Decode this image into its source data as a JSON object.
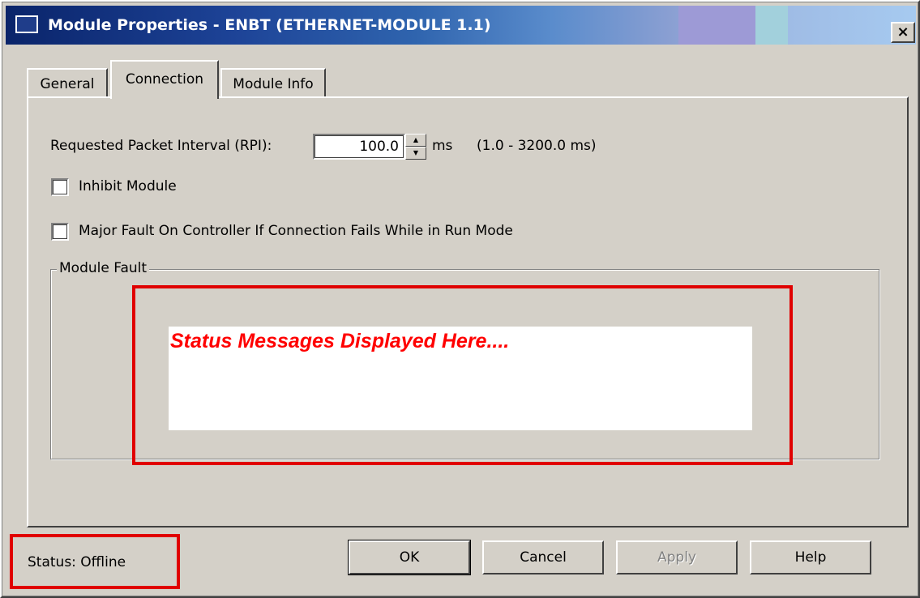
{
  "window": {
    "title": "Module Properties  - ENBT (ETHERNET-MODULE 1.1)",
    "close_label": "×"
  },
  "tabs": [
    {
      "label": "General",
      "active": false
    },
    {
      "label": "Connection",
      "active": true
    },
    {
      "label": "Module Info",
      "active": false
    }
  ],
  "connection": {
    "rpi_label": "Requested Packet Interval (RPI):",
    "rpi_value": "100.0",
    "rpi_unit": "ms",
    "rpi_range": "(1.0 - 3200.0 ms)",
    "inhibit_label": "Inhibit Module",
    "inhibit_checked": false,
    "major_fault_label": "Major Fault On Controller If Connection Fails While in Run Mode",
    "major_fault_checked": false
  },
  "module_fault": {
    "legend": "Module Fault",
    "status_message": "Status Messages Displayed Here...."
  },
  "status": {
    "text": "Status:  Offline"
  },
  "buttons": {
    "ok": "OK",
    "cancel": "Cancel",
    "apply": "Apply",
    "help": "Help"
  },
  "colors": {
    "title_start": "#0a246a",
    "title_end": "#a6caf0",
    "highlight": "#e00000",
    "status_message": "#ff0000",
    "dialog_face": "#d4d0c8"
  }
}
